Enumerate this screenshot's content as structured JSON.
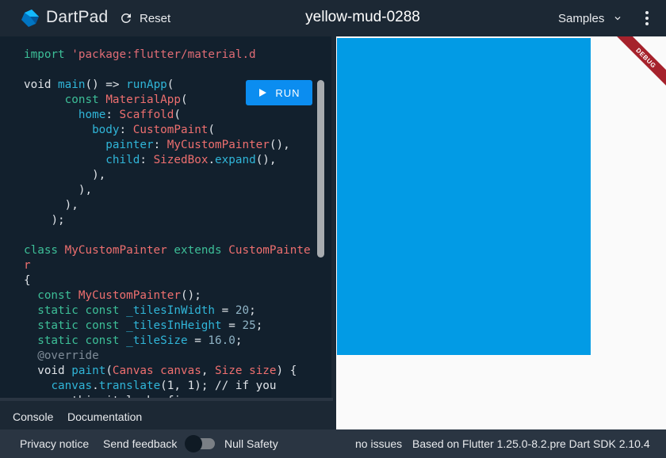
{
  "header": {
    "brand": "DartPad",
    "reset_label": "Reset",
    "pad_title": "yellow-mud-0288",
    "samples_label": "Samples"
  },
  "editor": {
    "run_label": "RUN",
    "code_lines": [
      [
        [
          "k",
          "import "
        ],
        [
          "s",
          "'package:flutter/material.d"
        ]
      ],
      [],
      [
        [
          "t",
          "void "
        ],
        [
          "f",
          "main"
        ],
        [
          "t",
          "() => "
        ],
        [
          "f",
          "runApp"
        ],
        [
          "t",
          "("
        ]
      ],
      [
        [
          "t",
          "      "
        ],
        [
          "k",
          "const "
        ],
        [
          "c",
          "MaterialApp"
        ],
        [
          "t",
          "("
        ]
      ],
      [
        [
          "t",
          "        "
        ],
        [
          "f",
          "home"
        ],
        [
          "t",
          ": "
        ],
        [
          "c",
          "Scaffold"
        ],
        [
          "t",
          "("
        ]
      ],
      [
        [
          "t",
          "          "
        ],
        [
          "f",
          "body"
        ],
        [
          "t",
          ": "
        ],
        [
          "c",
          "CustomPaint"
        ],
        [
          "t",
          "("
        ]
      ],
      [
        [
          "t",
          "            "
        ],
        [
          "f",
          "painter"
        ],
        [
          "t",
          ": "
        ],
        [
          "c",
          "MyCustomPainter"
        ],
        [
          "t",
          "(),"
        ]
      ],
      [
        [
          "t",
          "            "
        ],
        [
          "f",
          "child"
        ],
        [
          "t",
          ": "
        ],
        [
          "c",
          "SizedBox"
        ],
        [
          "t",
          "."
        ],
        [
          "f",
          "expand"
        ],
        [
          "t",
          "(),"
        ]
      ],
      [
        [
          "t",
          "          ),"
        ]
      ],
      [
        [
          "t",
          "        ),"
        ]
      ],
      [
        [
          "t",
          "      ),"
        ]
      ],
      [
        [
          "t",
          "    );"
        ]
      ],
      [],
      [
        [
          "k",
          "class "
        ],
        [
          "c",
          "MyCustomPainter "
        ],
        [
          "k",
          "extends "
        ],
        [
          "c",
          "CustomPainter"
        ]
      ],
      [
        [
          "t",
          "{"
        ]
      ],
      [
        [
          "t",
          "  "
        ],
        [
          "k",
          "const "
        ],
        [
          "c",
          "MyCustomPainter"
        ],
        [
          "t",
          "();"
        ]
      ],
      [
        [
          "t",
          "  "
        ],
        [
          "k",
          "static const "
        ],
        [
          "f",
          "_tilesInWidth"
        ],
        [
          "t",
          " = "
        ],
        [
          "n",
          "20"
        ],
        [
          "t",
          ";"
        ]
      ],
      [
        [
          "t",
          "  "
        ],
        [
          "k",
          "static const "
        ],
        [
          "f",
          "_tilesInHeight"
        ],
        [
          "t",
          " = "
        ],
        [
          "n",
          "25"
        ],
        [
          "t",
          ";"
        ]
      ],
      [
        [
          "t",
          "  "
        ],
        [
          "k",
          "static const "
        ],
        [
          "f",
          "_tileSize"
        ],
        [
          "t",
          " = "
        ],
        [
          "n",
          "16.0"
        ],
        [
          "t",
          ";"
        ]
      ],
      [
        [
          "t",
          "  "
        ],
        [
          "cm",
          "@override"
        ]
      ],
      [
        [
          "t",
          "  void "
        ],
        [
          "f",
          "paint"
        ],
        [
          "t",
          "("
        ],
        [
          "c",
          "Canvas canvas"
        ],
        [
          "t",
          ", "
        ],
        [
          "c",
          "Size size"
        ],
        [
          "t",
          ") {"
        ]
      ],
      [
        [
          "t",
          "    "
        ],
        [
          "f",
          "canvas"
        ],
        [
          "t",
          "."
        ],
        [
          "f",
          "translate"
        ],
        [
          "t",
          "(1, 1); // if you"
        ]
      ],
      [
        [
          "t",
          "remove this it looks fine"
        ]
      ]
    ]
  },
  "console_tabs": {
    "console_label": "Console",
    "docs_label": "Documentation"
  },
  "preview": {
    "debug_label": "DEBUG",
    "rect_color": "#029be5"
  },
  "footer": {
    "privacy_label": "Privacy notice",
    "feedback_label": "Send feedback",
    "null_safety_label": "Null Safety",
    "null_safety_enabled": false,
    "issues_text": "no issues",
    "sdk_text": "Based on Flutter 1.25.0-8.2.pre Dart SDK 2.10.4"
  },
  "colors": {
    "run_button": "#0b8df0",
    "header_bg": "#1c2834",
    "editor_bg": "#12202d",
    "footer_bg": "#2a3542",
    "debug_banner": "#a6222c"
  },
  "icons": {
    "logo": "dart-logo-icon",
    "reset": "refresh-icon",
    "samples": "chevron-down-icon",
    "more": "more-vert-icon",
    "run": "play-icon"
  }
}
